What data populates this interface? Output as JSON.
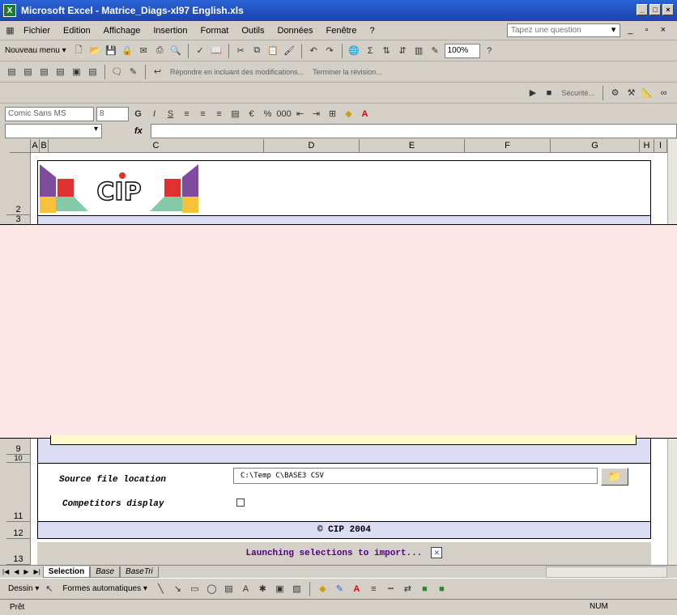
{
  "window": {
    "title": "Microsoft Excel - Matrice_Diags-xl97 English.xls",
    "min": "_",
    "max": "□",
    "close": "×"
  },
  "menubar": {
    "items": [
      "Fichier",
      "Edition",
      "Affichage",
      "Insertion",
      "Format",
      "Outils",
      "Données",
      "Fenêtre",
      "?"
    ],
    "help_placeholder": "Tapez une question"
  },
  "toolbar1": {
    "new_menu": "Nouveau menu ▾",
    "zoom": "100%"
  },
  "toolbar2": {
    "reply_text": "Répondre en incluant des modifications...",
    "end_review": "Terminer la révision..."
  },
  "toolbar3": {
    "security": "Sécurité..."
  },
  "toolbar4": {
    "font": "Comic Sans MS",
    "size": "8"
  },
  "formula": {
    "fx": "fx"
  },
  "columns": [
    "A",
    "B",
    "C",
    "D",
    "E",
    "F",
    "G",
    "H",
    "I"
  ],
  "rows": [
    "2",
    "3",
    "9",
    "10",
    "11",
    "12",
    "13"
  ],
  "logo": {
    "text": "CIP"
  },
  "form": {
    "source_label": "Source file location",
    "source_value": "C:\\Temp C\\BASE3 CSV",
    "competitors_label": "Competitors display",
    "competitors_checked": false
  },
  "footer": {
    "copyright": "© CIP 2004",
    "launching": "Launching selections to import..."
  },
  "sheet_tabs": [
    "Selection",
    "Base",
    "BaseTri"
  ],
  "drawbar": {
    "draw": "Dessin ▾",
    "autoshapes": "Formes automatiques ▾"
  },
  "status": {
    "ready": "Prêt",
    "num": "NUM"
  },
  "colors": {
    "band": "#dcdcf4",
    "overlay": "#fde6e6",
    "title": "#2a62d6",
    "purple": "#7e4b9e",
    "red": "#e03030",
    "green": "#86c9a8",
    "yellow": "#f6c23a"
  }
}
